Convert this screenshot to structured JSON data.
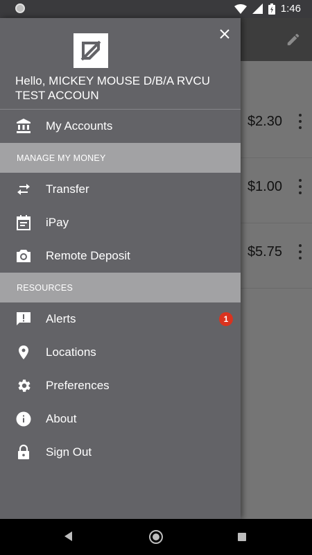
{
  "status_bar": {
    "time": "1:46"
  },
  "background": {
    "rows": [
      {
        "amount": "$2.30"
      },
      {
        "amount": "$1.00"
      },
      {
        "amount": "$5.75"
      }
    ]
  },
  "drawer": {
    "greeting": "Hello,  MICKEY MOUSE D/B/A RVCU TEST ACCOUN",
    "my_accounts": "My Accounts",
    "section_manage": "MANAGE MY MONEY",
    "transfer": "Transfer",
    "ipay": "iPay",
    "remote_deposit": "Remote Deposit",
    "section_resources": "RESOURCES",
    "alerts": "Alerts",
    "alerts_badge": "1",
    "locations": "Locations",
    "preferences": "Preferences",
    "about": "About",
    "sign_out": "Sign Out"
  },
  "colors": {
    "drawer_bg": "#636367",
    "section_bg": "#a2a2a4",
    "badge": "#d9331f"
  }
}
